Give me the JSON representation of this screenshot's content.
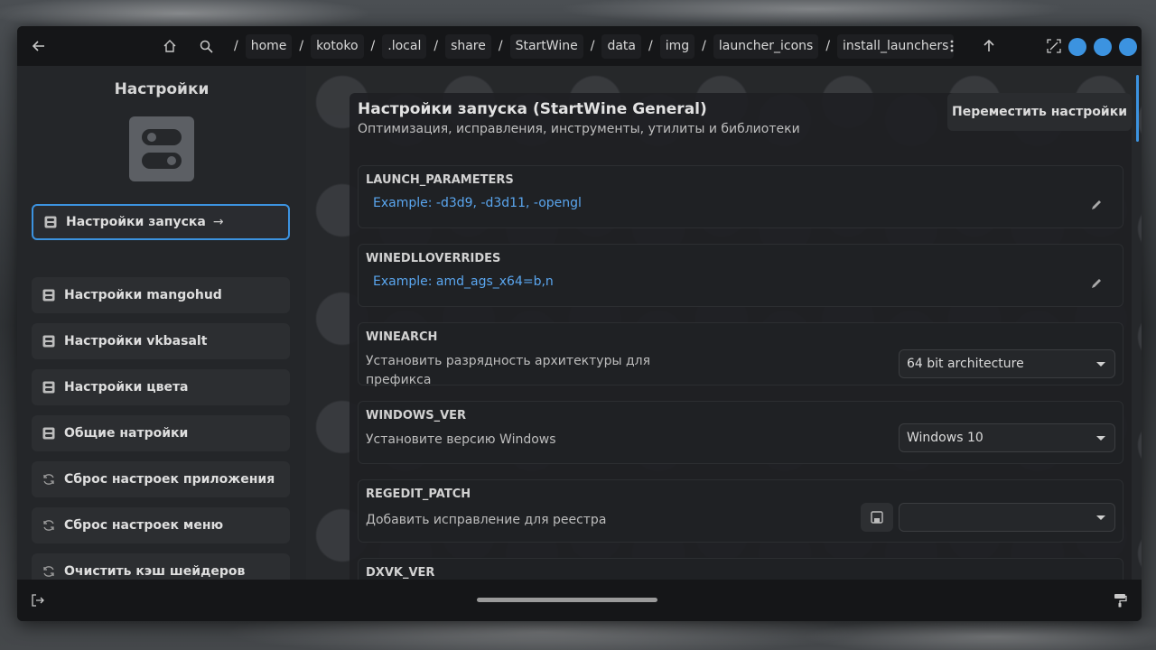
{
  "header": {
    "back_icon": "arrow-left-icon",
    "home_icon": "home-icon",
    "search_icon": "search-icon",
    "path": [
      "home",
      "kotoko",
      ".local",
      "share",
      "StartWine",
      "data",
      "img",
      "launcher_icons",
      "install_launchers"
    ],
    "menu_icon": "kebab-menu-icon",
    "up_icon": "arrow-up-icon",
    "fullscreen_icon": "fullscreen-icon",
    "accent": "#3c93e0"
  },
  "sidebar": {
    "title": "Настройки",
    "items": [
      {
        "label": "Настройки запуска",
        "icon": "settings-icon",
        "active": true
      },
      {
        "label": "Настройки mangohud",
        "icon": "settings-icon"
      },
      {
        "label": "Настройки vkbasalt",
        "icon": "settings-icon"
      },
      {
        "label": "Настройки цвета",
        "icon": "settings-icon"
      },
      {
        "label": "Общие натройки",
        "icon": "settings-icon"
      },
      {
        "label": "Сброс настроек приложения",
        "icon": "refresh-icon"
      },
      {
        "label": "Сброс настроек меню",
        "icon": "refresh-icon"
      },
      {
        "label": "Очистить кэш шейдеров",
        "icon": "refresh-icon"
      }
    ]
  },
  "main": {
    "title": "Настройки запуска (StartWine General)",
    "subtitle": "Оптимизация, исправления, инструменты, утилиты и библиотеки",
    "move_button": "Переместить настройки",
    "rows": {
      "launch_parameters": {
        "key": "LAUNCH_PARAMETERS",
        "placeholder": "Example: -d3d9, -d3d11, -opengl"
      },
      "winedlloverrides": {
        "key": "WINEDLLOVERRIDES",
        "placeholder": "Example: amd_ags_x64=b,n"
      },
      "winearch": {
        "key": "WINEARCH",
        "desc": "Установить разрядность архитектуры для префикса",
        "value": "64 bit architecture"
      },
      "windows_ver": {
        "key": "WINDOWS_VER",
        "desc": "Установите версию Windows",
        "value": "Windows 10"
      },
      "regedit_patch": {
        "key": "REGEDIT_PATCH",
        "desc": "Добавить исправление для реестра",
        "value": ""
      },
      "dxvk_ver": {
        "key": "DXVK_VER"
      }
    }
  },
  "footer": {
    "exit_icon": "exit-icon",
    "brush_icon": "paint-roller-icon"
  }
}
